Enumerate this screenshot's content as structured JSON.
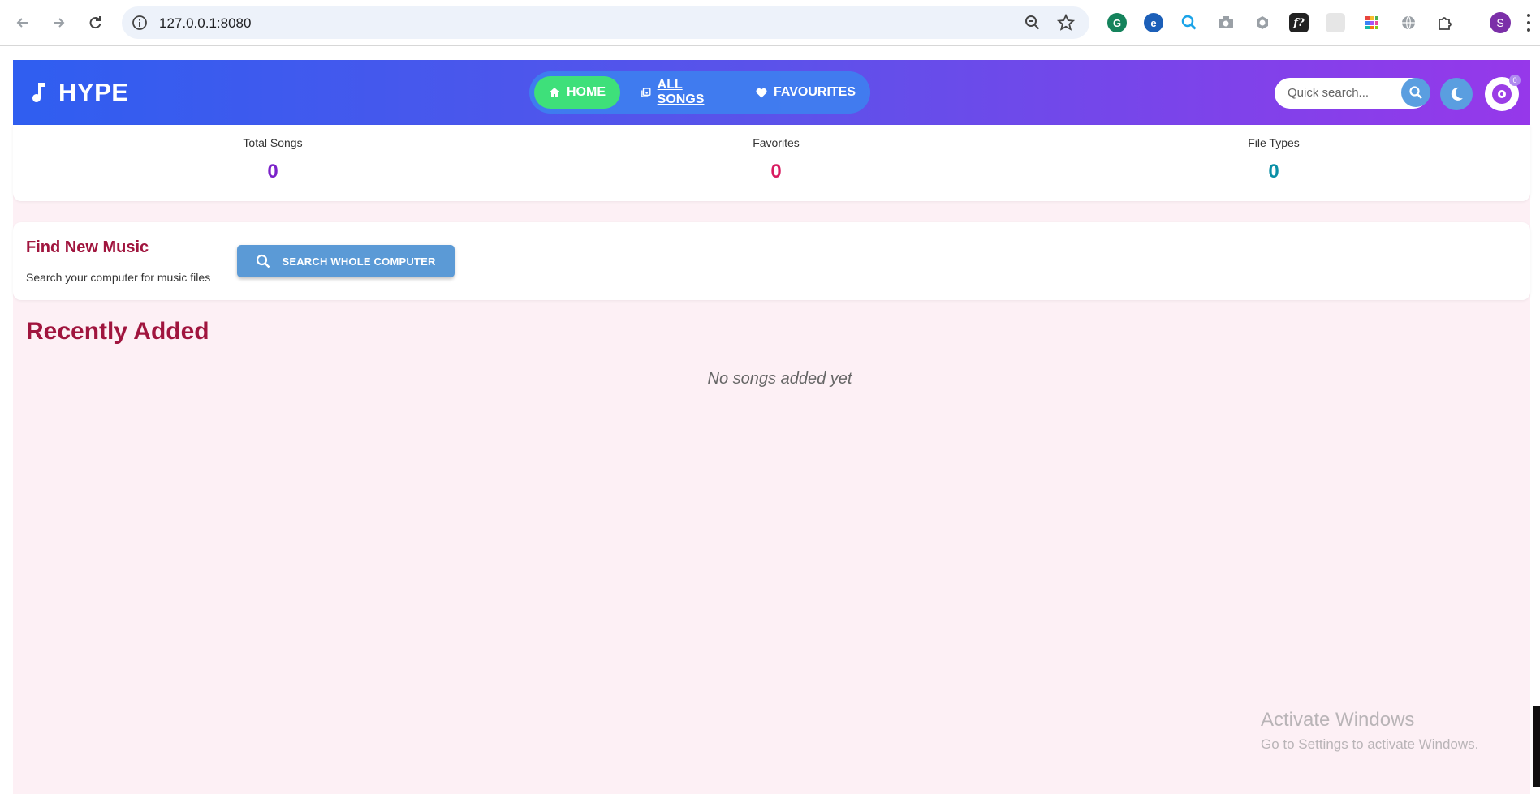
{
  "browser": {
    "url": "127.0.0.1:8080",
    "profile_initial": "S"
  },
  "app": {
    "brand": "HYPE",
    "nav": [
      {
        "label": "HOME",
        "icon": "home-icon",
        "active": true
      },
      {
        "label": "ALL SONGS",
        "icon": "library-icon",
        "active": false
      },
      {
        "label": "FAVOURITES",
        "icon": "heart-icon",
        "active": false
      }
    ],
    "search": {
      "placeholder": "Quick search..."
    },
    "player_badge": "0"
  },
  "stats": [
    {
      "label": "Total Songs",
      "value": "0",
      "color": "#7b22c9"
    },
    {
      "label": "Favorites",
      "value": "0",
      "color": "#d81b60"
    },
    {
      "label": "File Types",
      "value": "0",
      "color": "#0a8fa6"
    }
  ],
  "find": {
    "title": "Find New Music",
    "subtitle": "Search your computer for music files",
    "button_label": "SEARCH WHOLE COMPUTER"
  },
  "recent": {
    "title": "Recently Added",
    "empty_message": "No songs added yet"
  },
  "watermark": {
    "line1": "Activate Windows",
    "line2": "Go to Settings to activate Windows."
  },
  "colors": {
    "accent": "#a0153e",
    "header_start": "#2f5ef0",
    "header_end": "#9638ea",
    "active_nav": "#3ee07a",
    "page_bg": "#fdf0f5"
  }
}
